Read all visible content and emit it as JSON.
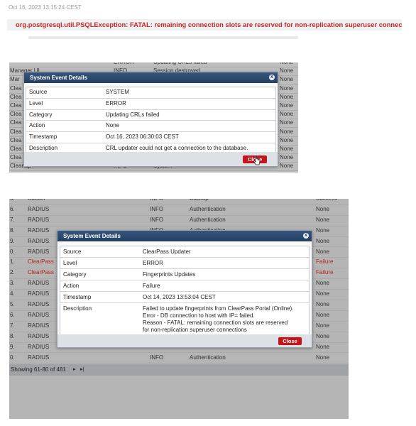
{
  "top": {
    "date_text": "Oct 16, 2023 13:15:24 CEST",
    "error_text": "org.postgresql.util.PSQLException: FATAL: remaining connection slots are reserved for non-replication superuser connections"
  },
  "panel1": {
    "rows": [
      {
        "c0": "",
        "c1": "ERROR",
        "c2": "Updating CRLs failed",
        "c3": "None"
      },
      {
        "c0": "Manager UI",
        "c1": "INFO",
        "c2": "Session destroyed",
        "c3": "None"
      },
      {
        "c0": "Mar",
        "c1": "",
        "c2": "",
        "c3": "None"
      },
      {
        "c0": "Clea",
        "c1": "",
        "c2": "",
        "c3": "None"
      },
      {
        "c0": "Clea",
        "c1": "",
        "c2": "",
        "c3": "None"
      },
      {
        "c0": "Clea",
        "c1": "",
        "c2": "",
        "c3": "None"
      },
      {
        "c0": "Clea",
        "c1": "",
        "c2": "",
        "c3": "None"
      },
      {
        "c0": "Clea",
        "c1": "",
        "c2": "",
        "c3": "None"
      },
      {
        "c0": "Clea",
        "c1": "",
        "c2": "",
        "c3": "None"
      },
      {
        "c0": "Clea",
        "c1": "",
        "c2": "",
        "c3": "None"
      },
      {
        "c0": "Clea",
        "c1": "",
        "c2": "",
        "c3": "None"
      },
      {
        "c0": "Clea",
        "c1": "",
        "c2": "",
        "c3": "None"
      },
      {
        "c0": "Cleanup",
        "c1": "INFO",
        "c2": "System",
        "c3": "None"
      }
    ],
    "dialog": {
      "title": "System Event Details",
      "close_x": "x",
      "rows": [
        {
          "label": "Source",
          "value": "SYSTEM"
        },
        {
          "label": "Level",
          "value": "ERROR"
        },
        {
          "label": "Category",
          "value": "Updating CRLs failed"
        },
        {
          "label": "Action",
          "value": "None"
        },
        {
          "label": "Timestamp",
          "value": "Oct 16, 2023 06:30:03 CEST"
        },
        {
          "label": "Description",
          "value": "CRL updater could not get a connection to the database."
        }
      ],
      "close_label": "Close"
    }
  },
  "panel2": {
    "rows": [
      {
        "n": "5.",
        "src": "Cluster",
        "level": "INFO",
        "cat": "Backup",
        "res": "Success",
        "red": false
      },
      {
        "n": "6.",
        "src": "RADIUS",
        "level": "INFO",
        "cat": "Authentication",
        "res": "None",
        "red": false
      },
      {
        "n": "7.",
        "src": "RADIUS",
        "level": "INFO",
        "cat": "Authentication",
        "res": "None",
        "red": false
      },
      {
        "n": "8.",
        "src": "RADIUS",
        "level": "INFO",
        "cat": "Authentication",
        "res": "None",
        "red": false
      },
      {
        "n": "9.",
        "src": "RADIUS",
        "level": "",
        "cat": "",
        "res": "None",
        "red": false
      },
      {
        "n": "0.",
        "src": "RADIUS",
        "level": "",
        "cat": "",
        "res": "None",
        "red": false
      },
      {
        "n": "1.",
        "src": "ClearPass",
        "level": "",
        "cat": "",
        "res": "Failure",
        "red": true
      },
      {
        "n": "2.",
        "src": "ClearPass",
        "level": "",
        "cat": "",
        "res": "Failure",
        "red": true
      },
      {
        "n": "3.",
        "src": "RADIUS",
        "level": "",
        "cat": "",
        "res": "None",
        "red": false
      },
      {
        "n": "4.",
        "src": "RADIUS",
        "level": "",
        "cat": "",
        "res": "None",
        "red": false
      },
      {
        "n": "5.",
        "src": "RADIUS",
        "level": "",
        "cat": "",
        "res": "None",
        "red": false
      },
      {
        "n": "6.",
        "src": "RADIUS",
        "level": "",
        "cat": "",
        "res": "None",
        "red": false
      },
      {
        "n": "7.",
        "src": "RADIUS",
        "level": "",
        "cat": "",
        "res": "None",
        "red": false
      },
      {
        "n": "8.",
        "src": "RADIUS",
        "level": "",
        "cat": "",
        "res": "None",
        "red": false
      },
      {
        "n": "9.",
        "src": "RADIUS",
        "level": "",
        "cat": "",
        "res": "None",
        "red": false
      },
      {
        "n": "0.",
        "src": "RADIUS",
        "level": "INFO",
        "cat": "Authentication",
        "res": "None",
        "red": false
      }
    ],
    "dialog": {
      "title": "System Event Details",
      "close_x": "x",
      "rows": [
        {
          "label": "Source",
          "value": "ClearPass Updater"
        },
        {
          "label": "Level",
          "value": "ERROR"
        },
        {
          "label": "Category",
          "value": "Fingerprints Updates"
        },
        {
          "label": "Action",
          "value": "Failure"
        },
        {
          "label": "Timestamp",
          "value": "Oct 14, 2023 13:53:04 CEST"
        }
      ],
      "description_label": "Description",
      "description_lines": [
        "Failed to update fingerprints from ClearPass Portal (Online).",
        "Error - DB connection to host with IP= failed.",
        "Reason - FATAL: remaining connection slots are reserved",
        "for non-replication superuser connections"
      ],
      "close_label": "Close"
    },
    "status_text": "Showing 61-80 of 481",
    "next_glyph": "▸",
    "last_glyph": "▸|"
  },
  "colors": {
    "dialog_title_bg": "#2c4a6e",
    "close_button": "#c4151c",
    "error_text": "#c62828",
    "failure_text": "#b3261e"
  }
}
